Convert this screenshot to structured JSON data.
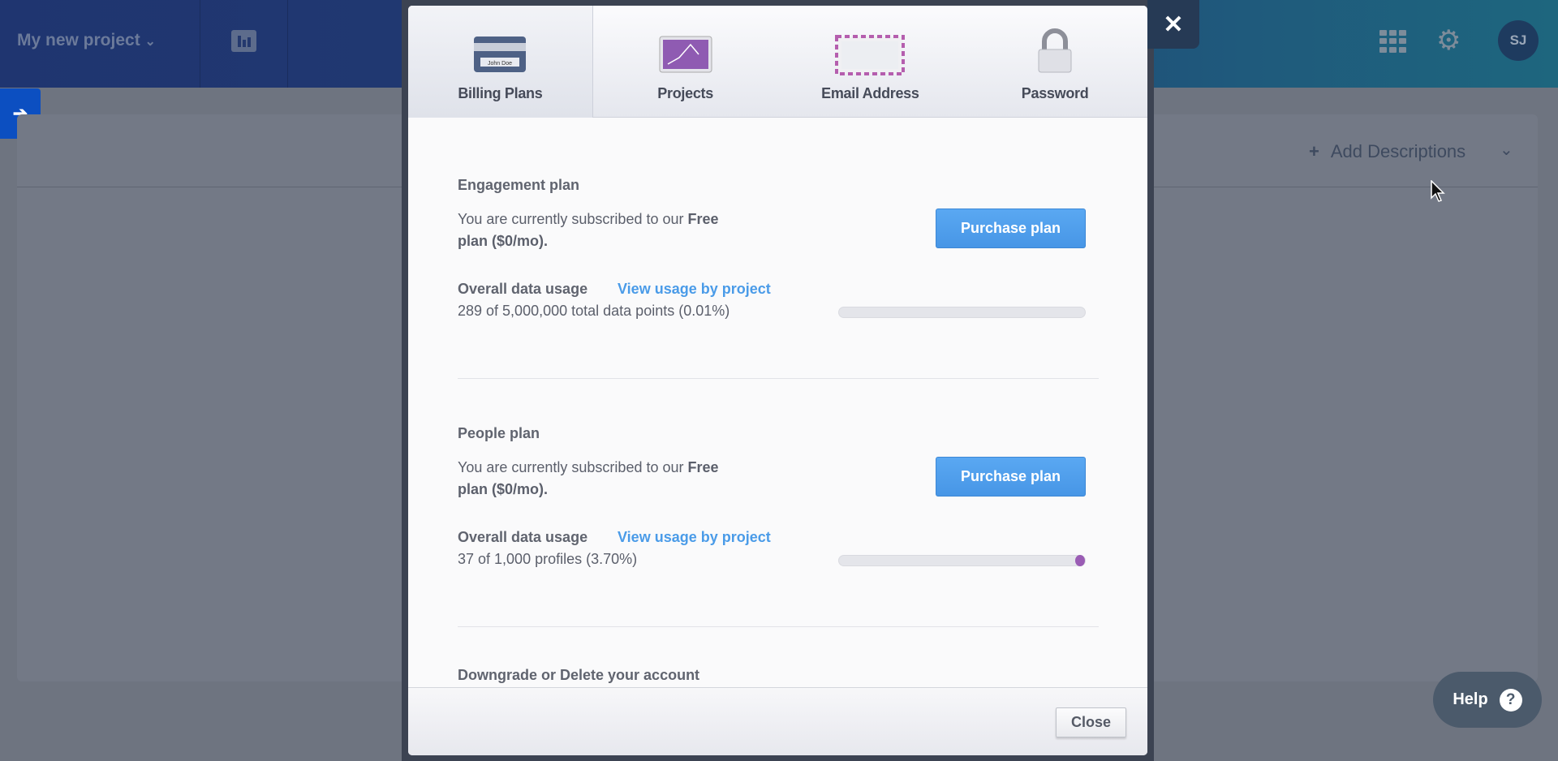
{
  "header": {
    "project_title": "My new project",
    "avatar_initials": "SJ"
  },
  "card": {
    "add_descriptions": "Add Descriptions"
  },
  "modal": {
    "tabs": [
      {
        "label": "Billing Plans",
        "active": true
      },
      {
        "label": "Projects"
      },
      {
        "label": "Email Address"
      },
      {
        "label": "Password"
      }
    ],
    "plans": [
      {
        "title": "Engagement plan",
        "subscribed_text": "You are currently subscribed to our ",
        "plan_name": "Free",
        "plan_price": "plan ($0/mo).",
        "purchase_label": "Purchase plan",
        "usage_label": "Overall data usage",
        "usage_link": "View usage by project",
        "usage_text": "289 of 5,000,000 total data points (0.01%)",
        "usage_percent": 0.01
      },
      {
        "title": "People plan",
        "subscribed_text": "You are currently subscribed to our ",
        "plan_name": "Free",
        "plan_price": "plan ($0/mo).",
        "purchase_label": "Purchase plan",
        "usage_label": "Overall data usage",
        "usage_link": "View usage by project",
        "usage_text": "37 of 1,000 profiles (3.70%)",
        "usage_percent": 3.7
      }
    ],
    "downgrade_title": "Downgrade or Delete your account",
    "close_label": "Close"
  },
  "help": {
    "label": "Help"
  },
  "colors": {
    "accent": "#4ea0ee",
    "usage_dot": "#9a5cb4",
    "header_left": "#1f3570",
    "header_right": "#1e667e"
  }
}
